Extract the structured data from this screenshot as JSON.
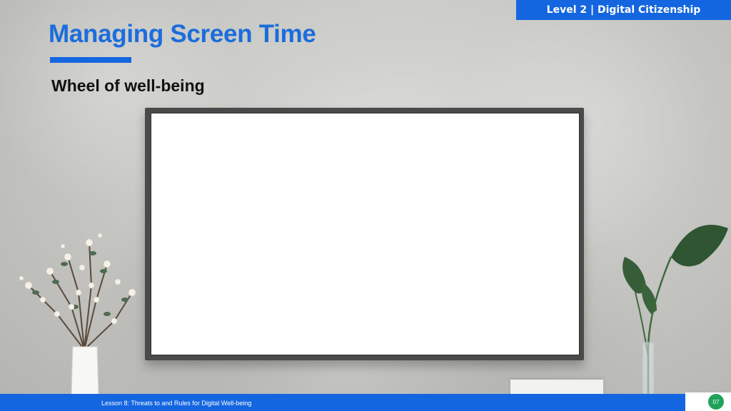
{
  "header": {
    "level_banner": "Level 2 | Digital Citizenship",
    "title": "Managing Screen Time",
    "subtitle": "Wheel of well-being"
  },
  "footer": {
    "lesson": "Lesson 8: Threats to and Rules for Digital Well-being",
    "page_number": "07"
  },
  "colors": {
    "accent_blue": "#1466e0",
    "title_blue": "#1b6ddb",
    "page_badge_green": "#21a25a"
  },
  "icons": [
    "flower-vase-icon",
    "monstera-plant-icon"
  ]
}
